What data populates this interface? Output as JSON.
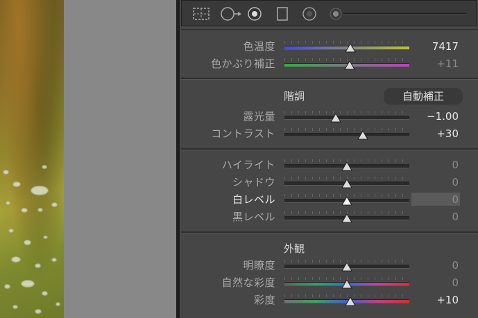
{
  "basic": {
    "temp_label": "色温度",
    "temp_value": "7417",
    "tint_label": "色かぶり補正",
    "tint_value": "+11"
  },
  "tone": {
    "header": "階調",
    "auto_label": "自動補正",
    "exposure_label": "露光量",
    "exposure_value": "−1.00",
    "contrast_label": "コントラスト",
    "contrast_value": "+30",
    "highlights_label": "ハイライト",
    "highlights_value": "0",
    "shadows_label": "シャドウ",
    "shadows_value": "0",
    "whites_label": "白レベル",
    "whites_value": "0",
    "blacks_label": "黒レベル",
    "blacks_value": "0"
  },
  "presence": {
    "header": "外観",
    "clarity_label": "明瞭度",
    "clarity_value": "0",
    "vibrance_label": "自然な彩度",
    "vibrance_value": "0",
    "saturation_label": "彩度",
    "saturation_value": "+10"
  },
  "slider_positions": {
    "temp": 0.53,
    "tint": 0.52,
    "exposure": 0.41,
    "contrast": 0.63,
    "highlights": 0.5,
    "shadows": 0.5,
    "whites": 0.5,
    "blacks": 0.5,
    "clarity": 0.5,
    "vibrance": 0.5,
    "saturation": 0.53
  },
  "colors": {
    "temp_gradient": [
      "#4a4ac8",
      "#b8c040"
    ],
    "tint_gradient": [
      "#30b040",
      "#c040c0"
    ],
    "vibrance_gradient": [
      "#606060",
      "#30a060",
      "#3070d0",
      "#c040a0",
      "#d03030"
    ],
    "saturation_gradient": [
      "#707070",
      "#40a060",
      "#4060d0",
      "#c04080",
      "#d03030"
    ]
  },
  "toolbar_icons": [
    "grid-crop-icon",
    "spot-removal-icon",
    "redeye-icon",
    "graduated-filter-icon",
    "radial-filter-icon",
    "adjustment-brush-icon"
  ]
}
